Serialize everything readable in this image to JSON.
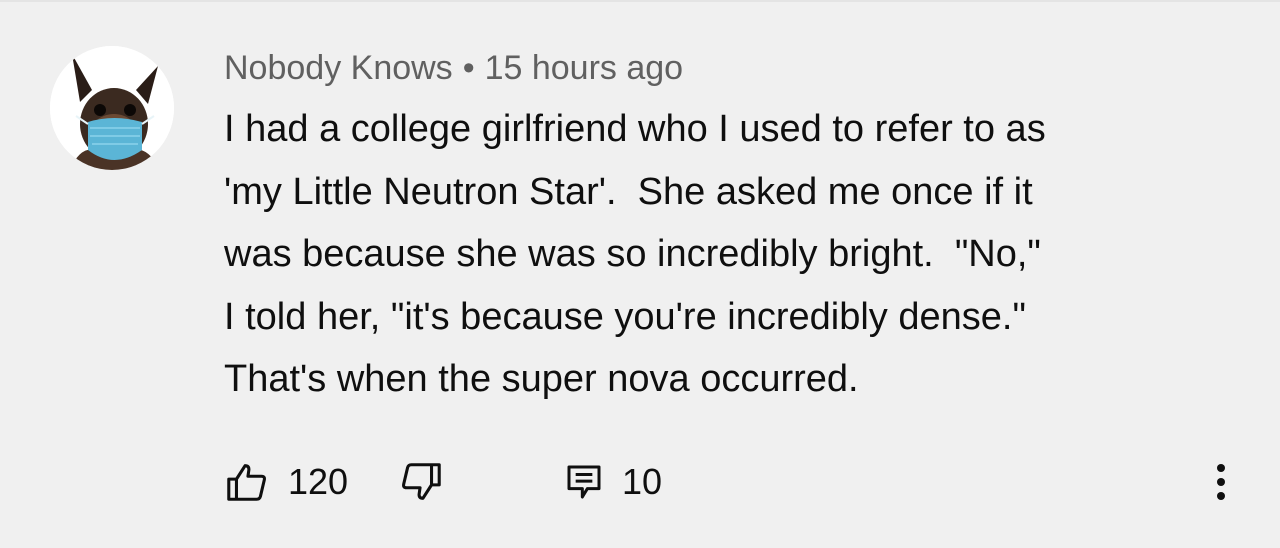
{
  "comment": {
    "author": "Nobody Knows",
    "separator": "•",
    "timestamp": "15 hours ago",
    "lines": [
      "I had a college girlfriend who I used to refer to as",
      "'my Little Neutron Star'.  She asked me once if it",
      "was because she was so incredibly bright.  \"No,\"",
      "I told her, \"it's because you're incredibly dense.\"",
      "That's when the super nova occurred."
    ]
  },
  "actions": {
    "likes": "120",
    "replies": "10",
    "icons": [
      "thumbs-up-icon",
      "thumbs-down-icon",
      "reply-icon",
      "more-vert-icon"
    ]
  },
  "colors": {
    "background": "#f0f0f0",
    "meta_text": "#606060",
    "body_text": "#0f0f0f",
    "mask": "#5bb5d6"
  }
}
